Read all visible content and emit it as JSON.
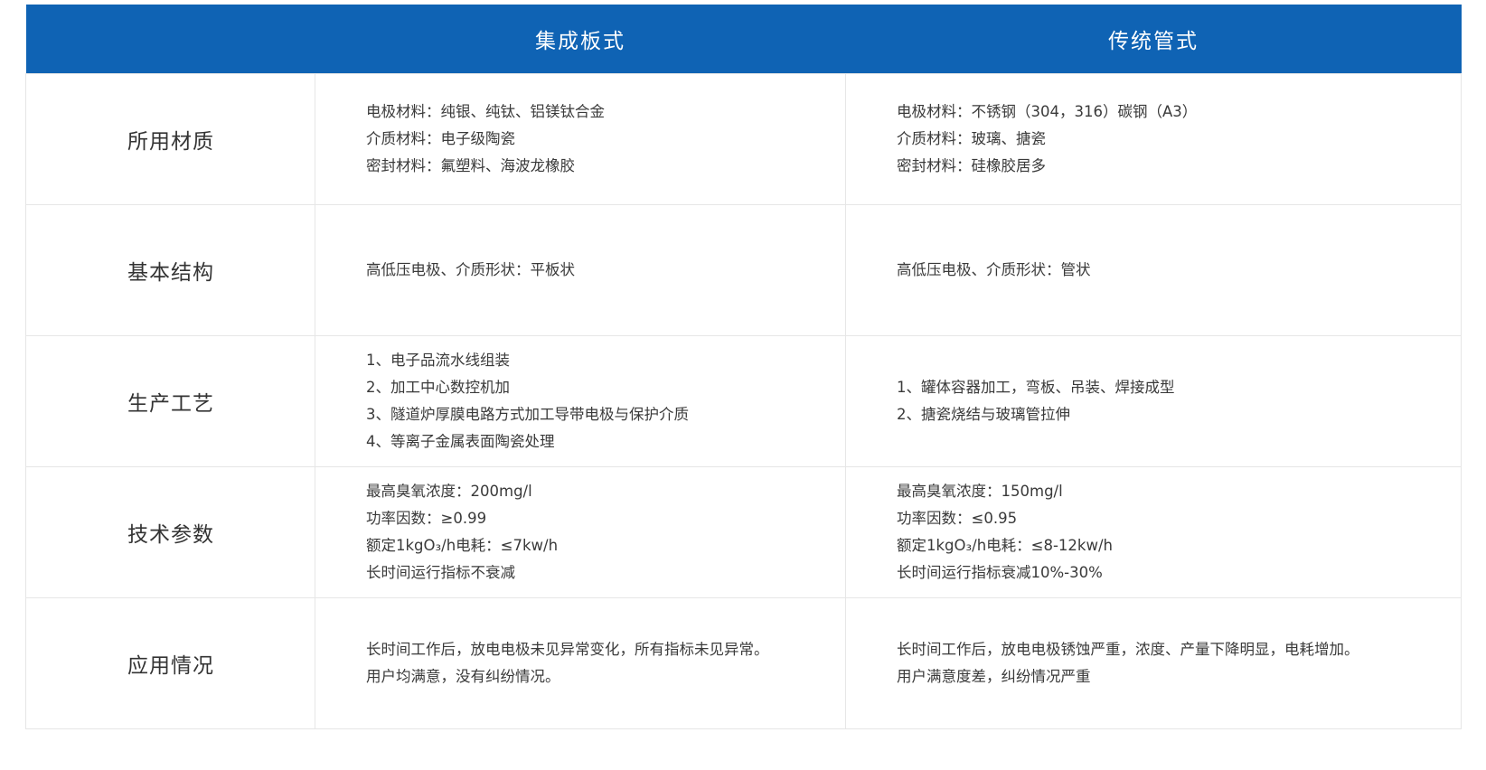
{
  "header": {
    "col1": "集成板式",
    "col2": "传统管式"
  },
  "rows": [
    {
      "label": "所用材质",
      "col1": [
        "电极材料：纯银、纯钛、铝镁钛合金",
        "介质材料：电子级陶瓷",
        "密封材料：氟塑料、海波龙橡胶"
      ],
      "col2": [
        "电极材料：不锈钢（304，316）碳钢（A3）",
        "介质材料：玻璃、搪瓷",
        "密封材料：硅橡胶居多"
      ]
    },
    {
      "label": "基本结构",
      "col1": [
        "高低压电极、介质形状：平板状"
      ],
      "col2": [
        "高低压电极、介质形状：管状"
      ]
    },
    {
      "label": "生产工艺",
      "col1": [
        "1、电子品流水线组装",
        "2、加工中心数控机加",
        "3、隧道炉厚膜电路方式加工导带电极与保护介质",
        "4、等离子金属表面陶瓷处理"
      ],
      "col2": [
        "1、罐体容器加工，弯板、吊装、焊接成型",
        "2、搪瓷烧结与玻璃管拉伸"
      ]
    },
    {
      "label": "技术参数",
      "col1": [
        "最高臭氧浓度：200mg/l",
        "功率因数：≥0.99",
        "额定1kgO₃/h电耗：≤7kw/h",
        "长时间运行指标不衰减"
      ],
      "col2": [
        "最高臭氧浓度：150mg/l",
        "功率因数：≤0.95",
        "额定1kgO₃/h电耗：≤8-12kw/h",
        "长时间运行指标衰减10%-30%"
      ]
    },
    {
      "label": "应用情况",
      "col1": [
        "长时间工作后，放电电极未见异常变化，所有指标未见异常。",
        "用户均满意，没有纠纷情况。"
      ],
      "col2": [
        "长时间工作后，放电电极锈蚀严重，浓度、产量下降明显，电耗增加。",
        "用户满意度差，纠纷情况严重"
      ]
    }
  ]
}
